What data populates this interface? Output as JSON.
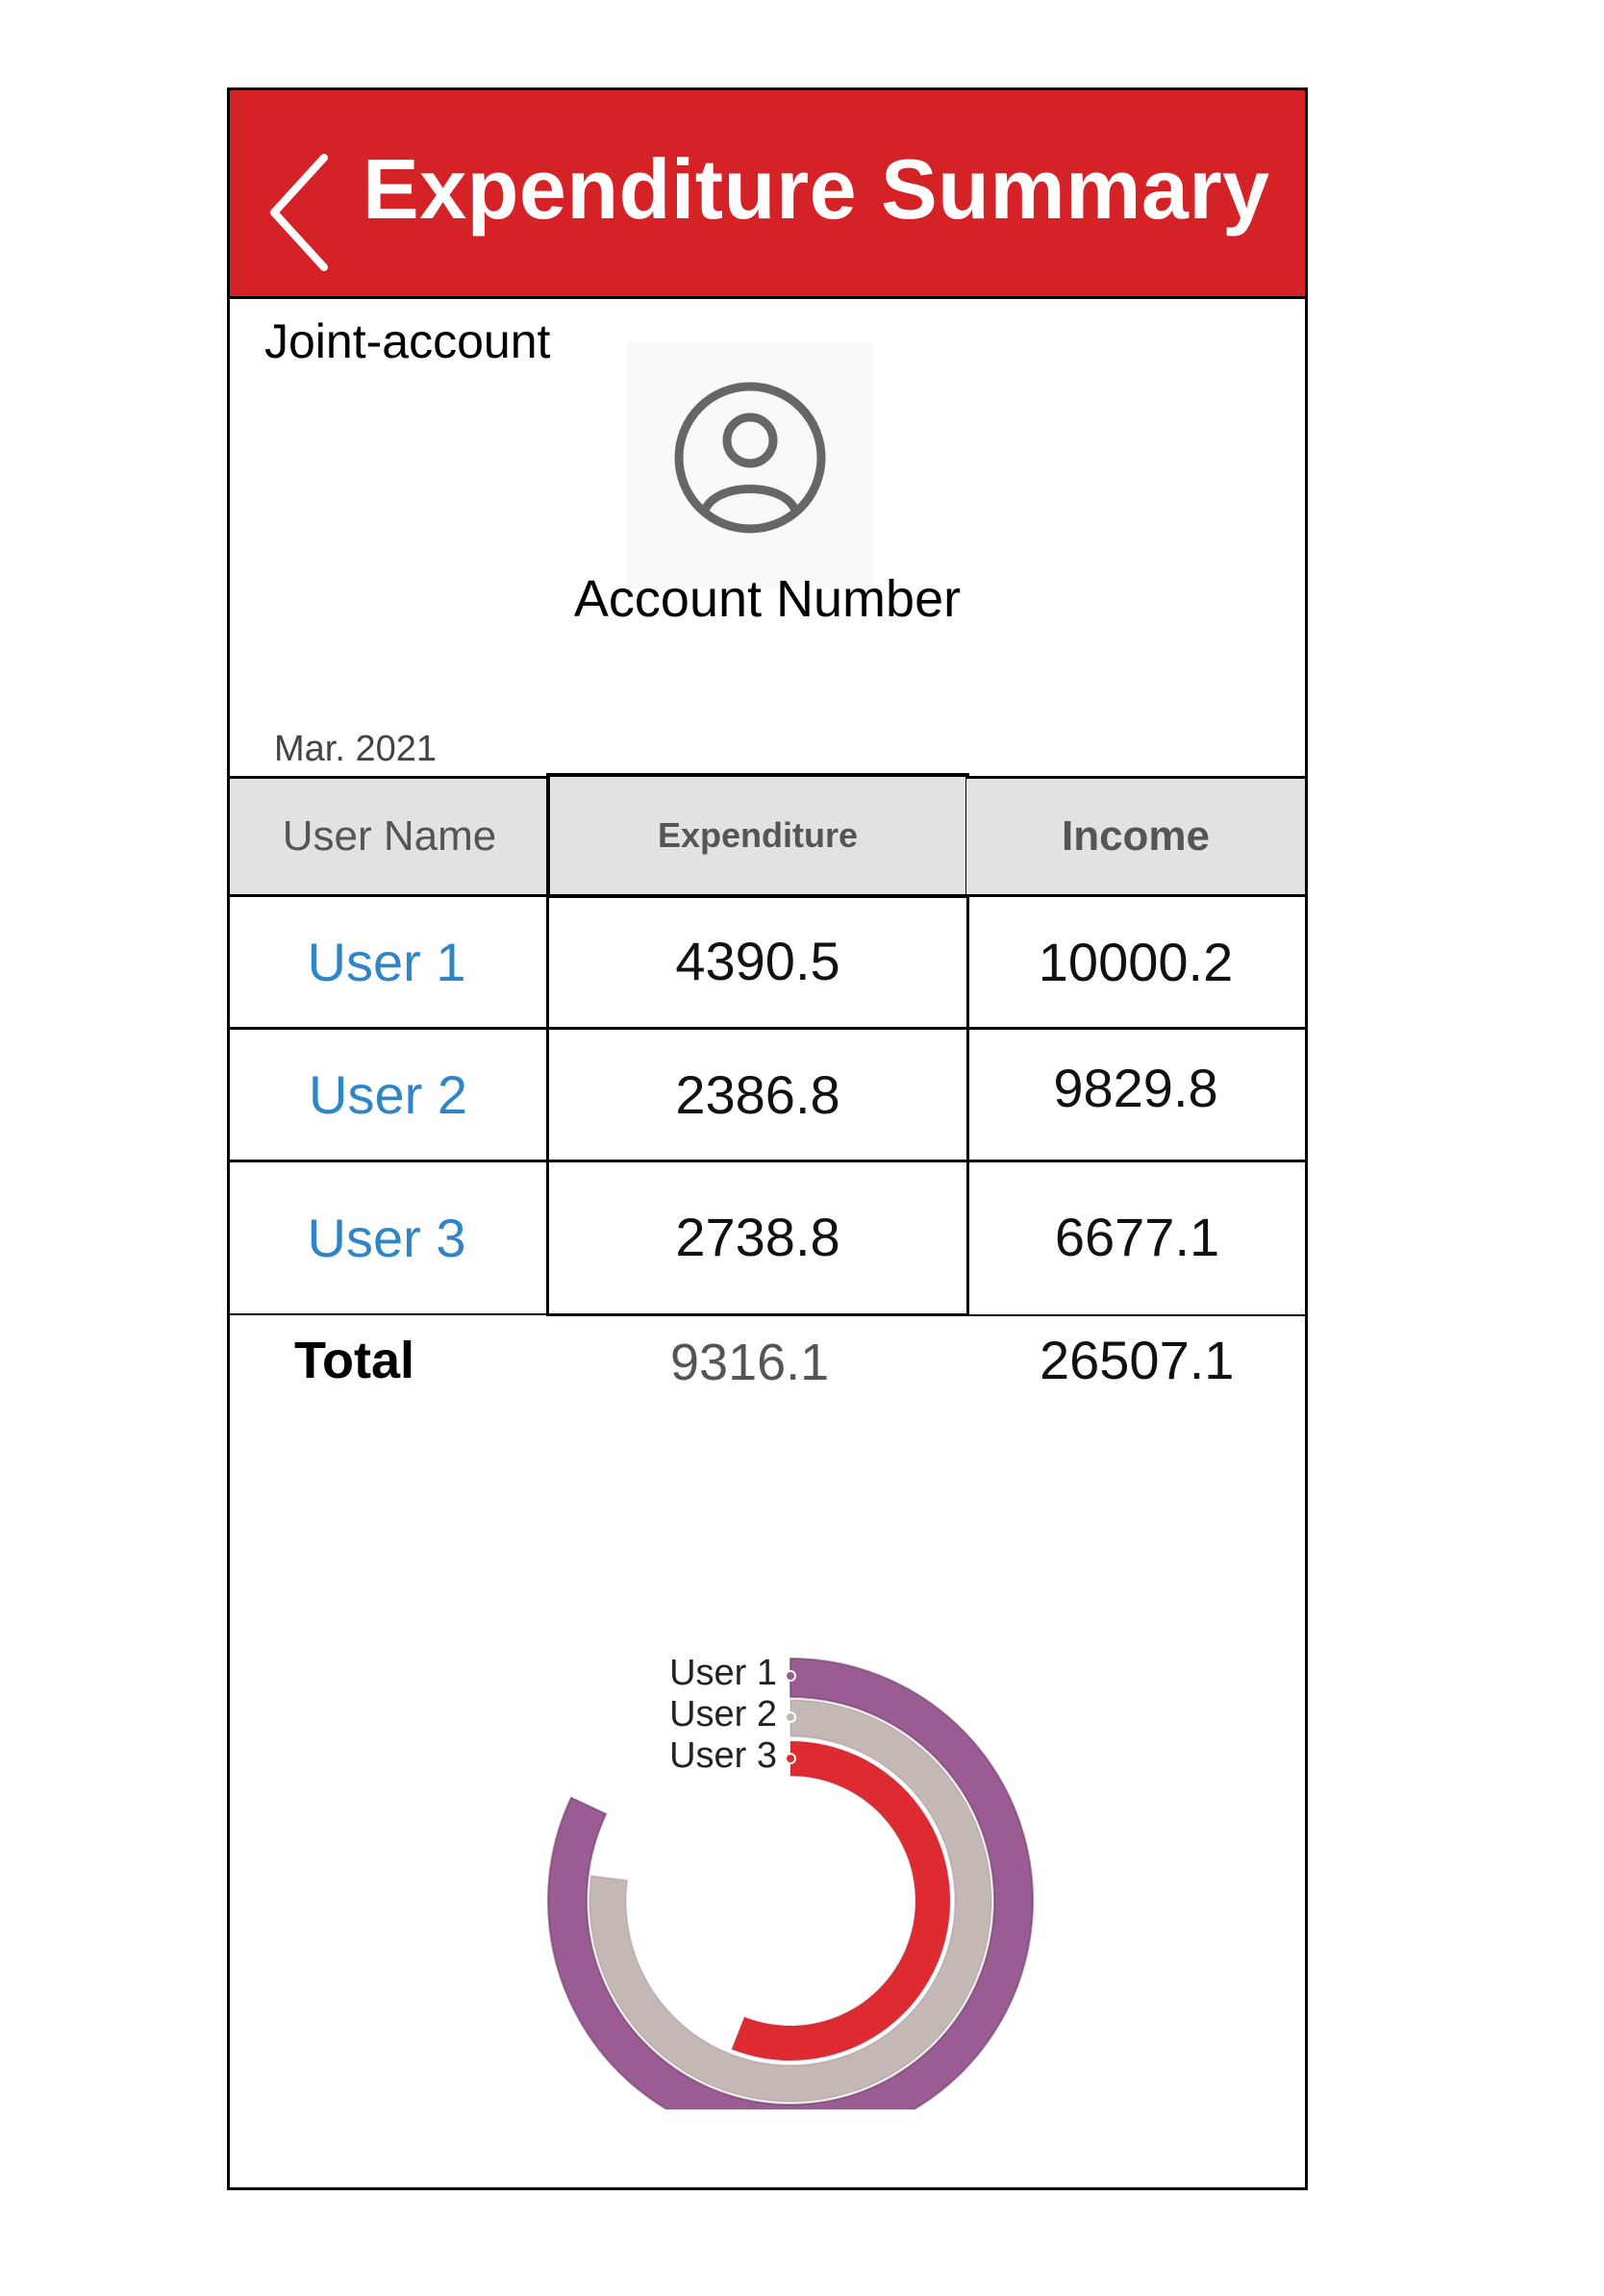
{
  "header": {
    "title": "Expenditure Summary",
    "back_icon": "chevron-left-icon",
    "background": "#d52226"
  },
  "account": {
    "type": "Joint-account",
    "avatar_icon": "user-circle-icon",
    "number_label": "Account Number"
  },
  "period": "Mar. 2021",
  "table": {
    "columns": [
      "User Name",
      "Expenditure",
      "Income"
    ],
    "rows": [
      {
        "user": "User 1",
        "expenditure": "4390.5",
        "income": "10000.2"
      },
      {
        "user": "User 2",
        "expenditure": "2386.8",
        "income": "9829.8"
      },
      {
        "user": "User 3",
        "expenditure": "2738.8",
        "income": "6677.1"
      }
    ],
    "total": {
      "label": "Total",
      "expenditure": "9316.1",
      "income": "26507.1"
    }
  },
  "chart_data": {
    "type": "radial-bar",
    "categories": [
      "User 1",
      "User 2",
      "User 3"
    ],
    "values": [
      0.82,
      0.77,
      0.56
    ],
    "colors": [
      "#9b5b93",
      "#c3b8b4",
      "#dd2b31"
    ]
  }
}
